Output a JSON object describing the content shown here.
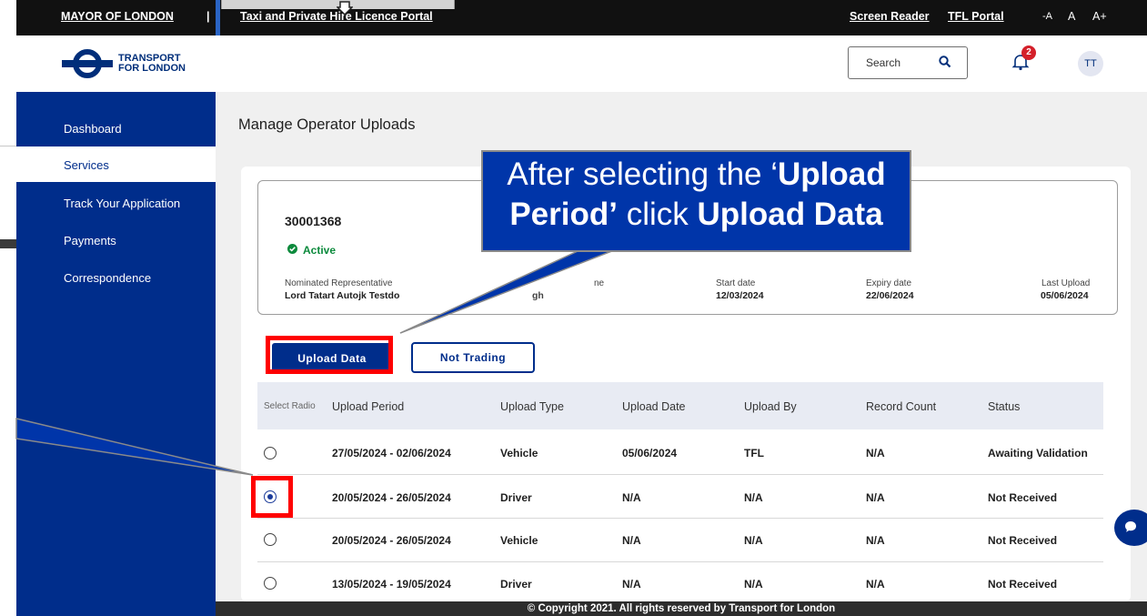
{
  "topbar": {
    "mayor": "MAYOR OF LONDON",
    "separator": "|",
    "portal_link": "Taxi and Private Hire Licence Portal",
    "screen_reader": "Screen Reader",
    "tfl_portal": "TFL Portal",
    "font_small": "-A",
    "font_normal": "A",
    "font_large": "A+"
  },
  "header": {
    "logo_line1": "TRANSPORT",
    "logo_line2": "FOR LONDON",
    "search_placeholder": "Search",
    "notification_count": "2",
    "avatar_initials": "TT"
  },
  "sidebar": {
    "items": [
      {
        "label": "Dashboard"
      },
      {
        "label": "Services"
      },
      {
        "label": "Track Your Application"
      },
      {
        "label": "Payments"
      },
      {
        "label": "Correspondence"
      }
    ]
  },
  "main": {
    "title": "Manage Operator Uploads",
    "operator": {
      "id": "30001368",
      "status": "Active",
      "nominated_rep_label": "Nominated Representative",
      "nominated_rep_value": "Lord Tatart Autojk Testdo",
      "name_label_fragment": "ne",
      "name_value_fragment": "gh",
      "start_label": "Start date",
      "start_value": "12/03/2024",
      "expiry_label": "Expiry date",
      "expiry_value": "22/06/2024",
      "last_upload_label": "Last Upload",
      "last_upload_value": "05/06/2024"
    },
    "buttons": {
      "upload": "Upload Data",
      "not_trading": "Not Trading"
    },
    "table": {
      "headers": [
        "Select Radio",
        "Upload Period",
        "Upload Type",
        "Upload Date",
        "Upload By",
        "Record Count",
        "Status"
      ],
      "rows": [
        {
          "period": "27/05/2024 - 02/06/2024",
          "type": "Vehicle",
          "date": "05/06/2024",
          "by": "TFL",
          "count": "N/A",
          "status": "Awaiting Validation",
          "selected": false
        },
        {
          "period": "20/05/2024 - 26/05/2024",
          "type": "Driver",
          "date": "N/A",
          "by": "N/A",
          "count": "N/A",
          "status": "Not Received",
          "selected": true
        },
        {
          "period": "20/05/2024 - 26/05/2024",
          "type": "Vehicle",
          "date": "N/A",
          "by": "N/A",
          "count": "N/A",
          "status": "Not Received",
          "selected": false
        },
        {
          "period": "13/05/2024 - 19/05/2024",
          "type": "Driver",
          "date": "N/A",
          "by": "N/A",
          "count": "N/A",
          "status": "Not Received",
          "selected": false
        }
      ]
    }
  },
  "callout": {
    "line1_a": "After selecting the ‘",
    "line1_b": "Upload",
    "line2_a": "Period’",
    "line2_b": " click ",
    "line2_c": "Upload Data"
  },
  "footer": {
    "text": "© Copyright 2021. All rights reserved by Transport for London"
  },
  "colors": {
    "brand_blue": "#002d8b",
    "highlight_red": "#ff0000",
    "active_green": "#0c8a3c"
  }
}
